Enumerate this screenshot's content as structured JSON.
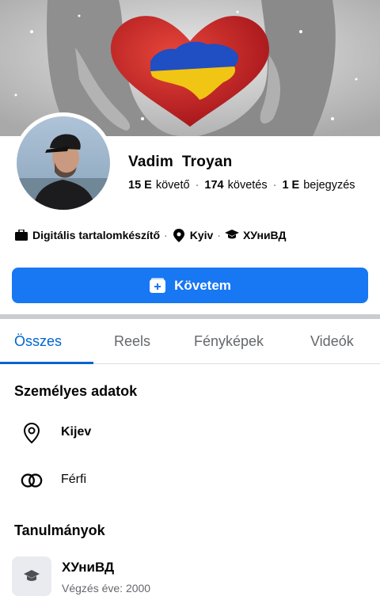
{
  "profile": {
    "name": "Vadim  Troyan",
    "stats": {
      "followers_value": "15 E",
      "followers_label": "követő",
      "following_value": "174",
      "following_label": "követés",
      "posts_value": "1 E",
      "posts_label": "bejegyzés",
      "separator": "·"
    },
    "info": {
      "job": "Digitális tartalomkészítő",
      "location": "Kyiv",
      "school": "ХУниВД",
      "separator": "·"
    }
  },
  "actions": {
    "follow_label": "Követem"
  },
  "tabs": [
    {
      "label": "Összes",
      "active": true
    },
    {
      "label": "Reels",
      "active": false
    },
    {
      "label": "Fényképek",
      "active": false
    },
    {
      "label": "Videók",
      "active": false
    }
  ],
  "personal": {
    "title": "Személyes adatok",
    "city": "Kijev",
    "gender": "Férfi"
  },
  "education": {
    "title": "Tanulmányok",
    "school": "ХУниВД",
    "graduation": "Végzés éve: 2000"
  },
  "colors": {
    "accent": "#1877f2",
    "active_tab": "#0064d1",
    "secondary_text": "#65676b",
    "flag_blue": "#0057b7",
    "flag_yellow": "#ffd700"
  },
  "icons": {
    "job": "briefcase-icon",
    "location": "location-pin-icon",
    "school": "graduation-cap-icon",
    "follow": "follow-card-icon",
    "gender": "gender-rings-icon"
  }
}
